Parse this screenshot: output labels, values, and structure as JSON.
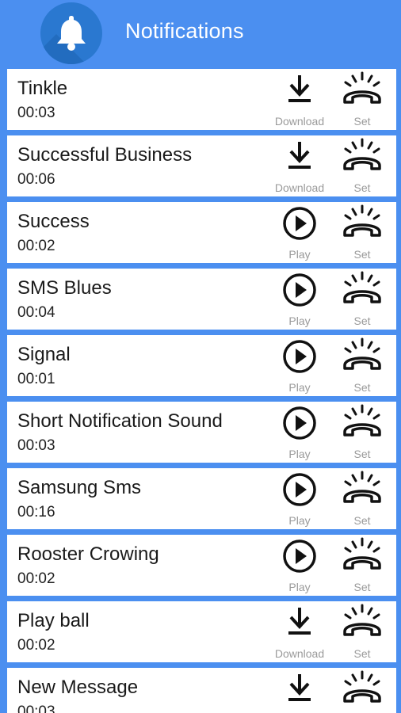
{
  "header": {
    "title": "Notifications",
    "icon": "bell-icon",
    "bg_color": "#4b8ff0"
  },
  "labels": {
    "download": "Download",
    "play": "Play",
    "set": "Set"
  },
  "rows": [
    {
      "name": "Tinkle",
      "duration": "00:03",
      "action": "download"
    },
    {
      "name": "Successful Business",
      "duration": "00:06",
      "action": "download"
    },
    {
      "name": "Success",
      "duration": "00:02",
      "action": "play"
    },
    {
      "name": "SMS Blues",
      "duration": "00:04",
      "action": "play"
    },
    {
      "name": "Signal",
      "duration": "00:01",
      "action": "play"
    },
    {
      "name": "Short Notification Sound",
      "duration": "00:03",
      "action": "play"
    },
    {
      "name": "Samsung Sms",
      "duration": "00:16",
      "action": "play"
    },
    {
      "name": "Rooster Crowing",
      "duration": "00:02",
      "action": "play"
    },
    {
      "name": "Play ball",
      "duration": "00:02",
      "action": "download"
    },
    {
      "name": "New Message",
      "duration": "00:03",
      "action": "download"
    }
  ]
}
